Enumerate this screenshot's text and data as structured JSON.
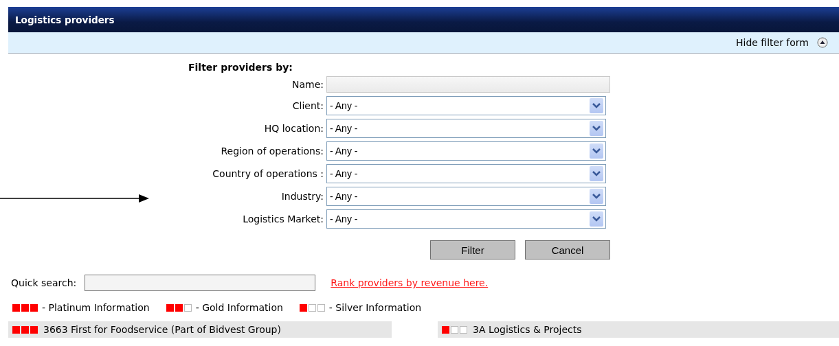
{
  "header": {
    "title": "Logistics providers"
  },
  "toolbar": {
    "toggle_label": "Hide filter form"
  },
  "filter_form": {
    "heading": "Filter providers by:",
    "fields": [
      {
        "kind": "text",
        "label": "Name:"
      },
      {
        "kind": "select",
        "label": "Client:",
        "value": "- Any -"
      },
      {
        "kind": "select",
        "label": "HQ location:",
        "value": "- Any -"
      },
      {
        "kind": "select",
        "label": "Region of operations:",
        "value": "- Any -"
      },
      {
        "kind": "select",
        "label": "Country of operations :",
        "value": "- Any -"
      },
      {
        "kind": "select",
        "label": "Industry:",
        "value": "- Any -"
      },
      {
        "kind": "select",
        "label": "Logistics Market:",
        "value": "- Any -"
      }
    ],
    "buttons": [
      "Filter",
      "Cancel"
    ]
  },
  "quick_search": {
    "label": "Quick search:",
    "link": "Rank providers by revenue here."
  },
  "legend": [
    {
      "stars": 3,
      "label": "- Platinum Information"
    },
    {
      "stars": 2,
      "label": "- Gold Information"
    },
    {
      "stars": 1,
      "label": "- Silver Information"
    }
  ],
  "providers": [
    {
      "stars": 3,
      "name": "3663 First for Foodservice (Part of Bidvest Group)"
    },
    {
      "stars": 1,
      "name": "3A Logistics & Projects"
    }
  ]
}
